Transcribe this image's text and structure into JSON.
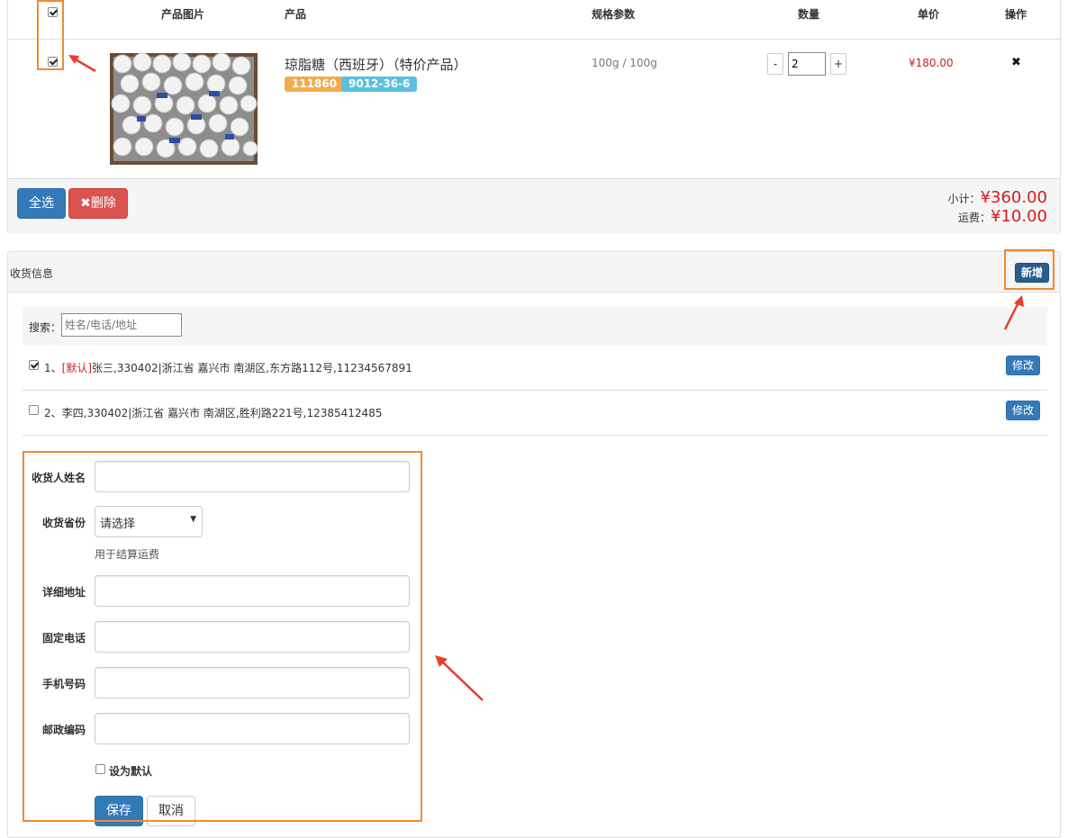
{
  "cart": {
    "columns": {
      "image": "产品图片",
      "product": "产品",
      "spec": "规格参数",
      "quantity": "数量",
      "price": "单价",
      "action": "操作"
    },
    "item": {
      "name": "琼脂糖（西班牙）（特价产品）",
      "code": "111860",
      "cas": "9012-36-6",
      "spec": "100g / 100g",
      "qty_minus": "-",
      "qty_value": "2",
      "qty_plus": "+",
      "price": "¥180.00",
      "remove": "✖"
    },
    "select_all_label": "全选",
    "delete_label": "✖删除",
    "subtotal_label": "小计：",
    "subtotal_value": "¥360.00",
    "shipping_label": "运费：",
    "shipping_value": "¥10.00"
  },
  "address": {
    "title": "收货信息",
    "add_button": "新增",
    "search_label": "搜索：",
    "search_placeholder": "姓名/电话/地址",
    "rows": [
      {
        "index": "1、",
        "default_tag": "[默认]",
        "text": "张三,330402|浙江省 嘉兴市 南湖区,东方路112号,11234567891",
        "edit": "修改",
        "checked": true
      },
      {
        "index": "2、",
        "default_tag": "",
        "text": "李四,330402|浙江省 嘉兴市 南湖区,胜利路221号,12385412485",
        "edit": "修改",
        "checked": false
      }
    ],
    "form": {
      "name_label": "收货人姓名",
      "province_label": "收货省份",
      "province_value": "请选择",
      "province_help": "用于结算运费",
      "detail_label": "详细地址",
      "phone_label": "固定电话",
      "mobile_label": "手机号码",
      "zip_label": "邮政编码",
      "default_label": "设为默认",
      "save": "保存",
      "cancel": "取消"
    }
  },
  "colors": {
    "primary": "#337ab7",
    "danger": "#d9534f",
    "annotation": "#f08a33",
    "price_red": "#d21c1c",
    "badge_orange": "#f0ad4e",
    "badge_blue": "#5bc0de"
  }
}
